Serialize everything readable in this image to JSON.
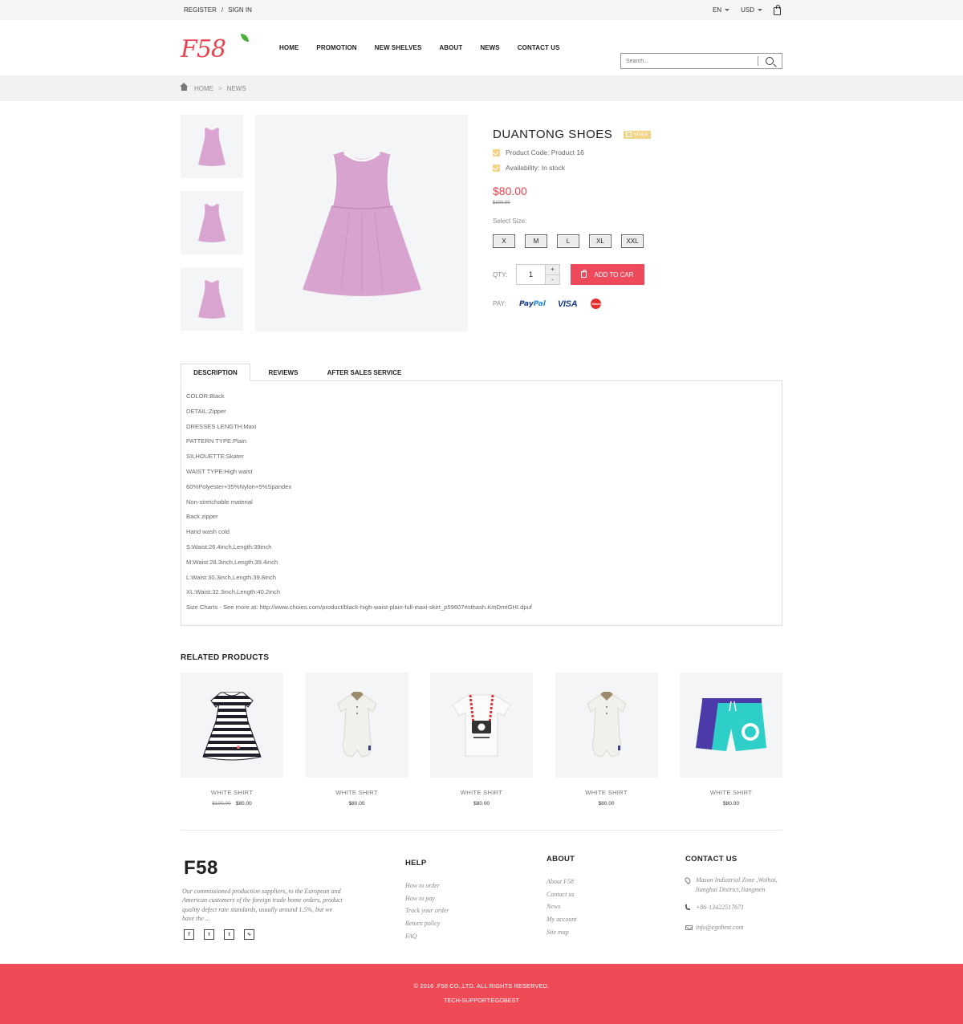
{
  "topbar": {
    "register": "REGISTER",
    "sep": "/",
    "signin": "SIGN IN",
    "lang": "EN",
    "currency": "USD"
  },
  "header": {
    "logo": "F58",
    "nav": [
      "HOME",
      "PROMOTION",
      "NEW SHELVES",
      "ABOUT",
      "NEWS",
      "CONTACT US"
    ],
    "search_placeholder": "Search..."
  },
  "breadcrumb": {
    "home": "HOME",
    "sep": ">",
    "current": "NEWS"
  },
  "product": {
    "title": "DUANTONG SHOES",
    "share": "share",
    "code": "Product Code: Product 16",
    "availability": "Availability: In stock",
    "price": "$80.00",
    "old_price": "$100.00",
    "size_label": "Select Size:",
    "sizes": [
      "X",
      "M",
      "L",
      "XL",
      "XXL"
    ],
    "qty_label": "QTY:",
    "qty": "1",
    "plus": "+",
    "minus": "-",
    "add_to_cart": "ADD TO CAR",
    "pay_label": "PAY:",
    "pay_methods": [
      "PayPal",
      "VISA",
      "MasterCard"
    ],
    "image_color": "#d9a4cf"
  },
  "tabs": {
    "labels": [
      "DESCRIPTION",
      "REVIEWS",
      "AFTER SALES SERVICE"
    ],
    "description": [
      "COLOR:Black",
      "DETAIL:Zipper",
      "DRESSES LENGTH:Maxi",
      "PATTERN TYPE:Plain",
      "SILHOUETTE:Skater",
      "WAIST TYPE:High waist",
      "60%Polyester+35%Nylon+5%Spandex",
      "Non-stretchable material",
      "Back zipper",
      "Hand wash cold",
      "S:Waist:26.4inch,Length:39inch",
      "M:Waist:28.3inch,Length:39.4inch",
      "L:Waist:30.3inch,Length:39.8inch",
      "XL:Waist:32.3inch,Length:40.2inch",
      "Size Charts - See more at: http://www.choies.com/product/black-high-waist-plain-full-maxi-skirt_p59607#sthash.KmDmtGHI.dpuf"
    ]
  },
  "related": {
    "title": "RELATED PRODUCTS",
    "items": [
      {
        "name": "WHITE SHIRT",
        "old": "$100.00",
        "price": "$80.00"
      },
      {
        "name": "WHITE SHIRT",
        "old": "",
        "price": "$80.00"
      },
      {
        "name": "WHITE SHIRT",
        "old": "",
        "price": "$80.00"
      },
      {
        "name": "WHITE SHIRT",
        "old": "",
        "price": "$80.00"
      },
      {
        "name": "WHITE SHIRT",
        "old": "",
        "price": "$80.00"
      }
    ]
  },
  "footer": {
    "brand": "F58",
    "desc": "Our commissioned production suppliers, to the European and American customers of the foreign trade home orders, product quality defect rate standards, usually around 1.5%, but we have the ...",
    "socials": [
      "f",
      "t",
      "t",
      "rss"
    ],
    "help": {
      "title": "HELP",
      "links": [
        "How to order",
        "How to pay",
        "Track your order",
        "Return policy",
        "FAQ"
      ]
    },
    "about": {
      "title": "ABOUT",
      "links": [
        "About F58",
        "Contact us",
        "News",
        "My account",
        "Site map"
      ]
    },
    "contact": {
      "title": "CONTACT US",
      "address1": "Masan Industrial Zone ,Waihai,",
      "address2": "Jianghai District,Jiangmen",
      "phone": "+86-13422517671",
      "email": "info@egobest.com"
    },
    "copyright": "© 2016 .F58 CO.,LTD.  ALL RIGHTS RESERVED.",
    "support": "TECH-SUPPORT:EGOBEST"
  },
  "colors": {
    "accent": "#ef4b57",
    "price": "#e8414b",
    "check": "#f3d58a"
  }
}
